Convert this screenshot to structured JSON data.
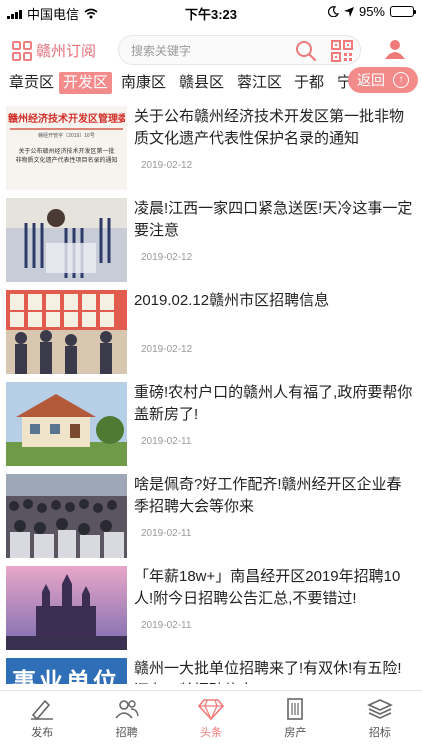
{
  "status_bar": {
    "carrier": "中国电信",
    "time": "下午3:23",
    "battery": "95%",
    "battery_level": 0.95
  },
  "header": {
    "brand": "赣州订阅",
    "search_placeholder": "搜索关键字"
  },
  "tabs": [
    {
      "label": "章贡区",
      "active": false
    },
    {
      "label": "开发区",
      "active": true
    },
    {
      "label": "南康区",
      "active": false
    },
    {
      "label": "赣县区",
      "active": false
    },
    {
      "label": "蓉江区",
      "active": false
    },
    {
      "label": "于都",
      "active": false
    },
    {
      "label": "宁",
      "active": false
    }
  ],
  "back_button": "返回",
  "articles": [
    {
      "title": "关于公布赣州经济技术开发区第一批非物质文化遗产代表性保护名录的通知",
      "date": "2019-02-12",
      "thumb": "document"
    },
    {
      "title": "凌晨!江西一家四口紧急送医!天冷这事一定要注意",
      "date": "2019-02-12",
      "thumb": "hospital"
    },
    {
      "title": "2019.02.12赣州市区招聘信息",
      "date": "2019-02-12",
      "thumb": "crowd-board"
    },
    {
      "title": "重磅!农村户口的赣州人有福了,政府要帮你盖新房了!",
      "date": "2019-02-11",
      "thumb": "house"
    },
    {
      "title": "啥是佩奇?好工作配齐!赣州经开区企业春季招聘大会等你来",
      "date": "2019-02-11",
      "thumb": "job-fair"
    },
    {
      "title": "「年薪18w+」南昌经开区2019年招聘10人!附今日招聘公告汇总,不要错过!",
      "date": "2019-02-11",
      "thumb": "castle"
    },
    {
      "title": "赣州一大批单位招聘来了!有双休!有五险!还有工龄招聘信息!",
      "date": "",
      "thumb": "banner"
    }
  ],
  "thumb_texts": {
    "doc_heading": "赣州经济技术开发区管理委员会",
    "doc_number": "赣经开管字〔2019〕16号",
    "doc_line1": "关于公布赣州经济技术开发区第一批",
    "doc_line2": "非物质文化遗产代表性项目名录的通知",
    "banner_text": "事业单位"
  },
  "bottom_nav": [
    {
      "label": "发布",
      "icon": "pen-icon",
      "active": false
    },
    {
      "label": "招聘",
      "icon": "people-icon",
      "active": false
    },
    {
      "label": "头条",
      "icon": "diamond-icon",
      "active": true
    },
    {
      "label": "房产",
      "icon": "building-icon",
      "active": false
    },
    {
      "label": "招标",
      "icon": "layers-icon",
      "active": false
    }
  ],
  "colors": {
    "accent": "#f48b8b",
    "accent_text": "#e5707a"
  }
}
